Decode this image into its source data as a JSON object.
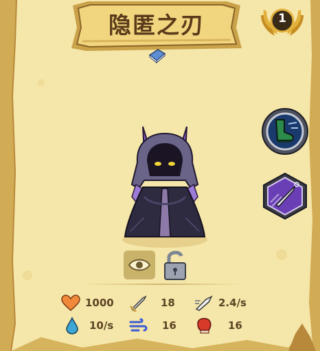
{
  "hero": {
    "name": "隐匿之刃",
    "level": "1"
  },
  "stats": {
    "health": "1000",
    "attack": "18",
    "attack_speed": "2.4/s",
    "regen": "10/s",
    "speed": "16",
    "armor": "16"
  },
  "icons": {
    "health": "heart-icon",
    "attack": "sword-icon",
    "attack_speed": "speed-sword-icon",
    "regen": "water-drop-icon",
    "speed": "wind-icon",
    "armor": "boxing-glove-icon",
    "skill_1": "boots-icon",
    "skill_2": "kunai-icon",
    "toggle": "eye-icon",
    "unlock": "open-padlock-icon",
    "badge": "level-badge-icon",
    "info": "book-icon"
  },
  "colors": {
    "parchment": "#f5e6a9",
    "banner": "#f2d67f",
    "text": "#5b4424",
    "skill_purple": "#6a3fb5",
    "skill_blue": "#1a3a6e"
  }
}
